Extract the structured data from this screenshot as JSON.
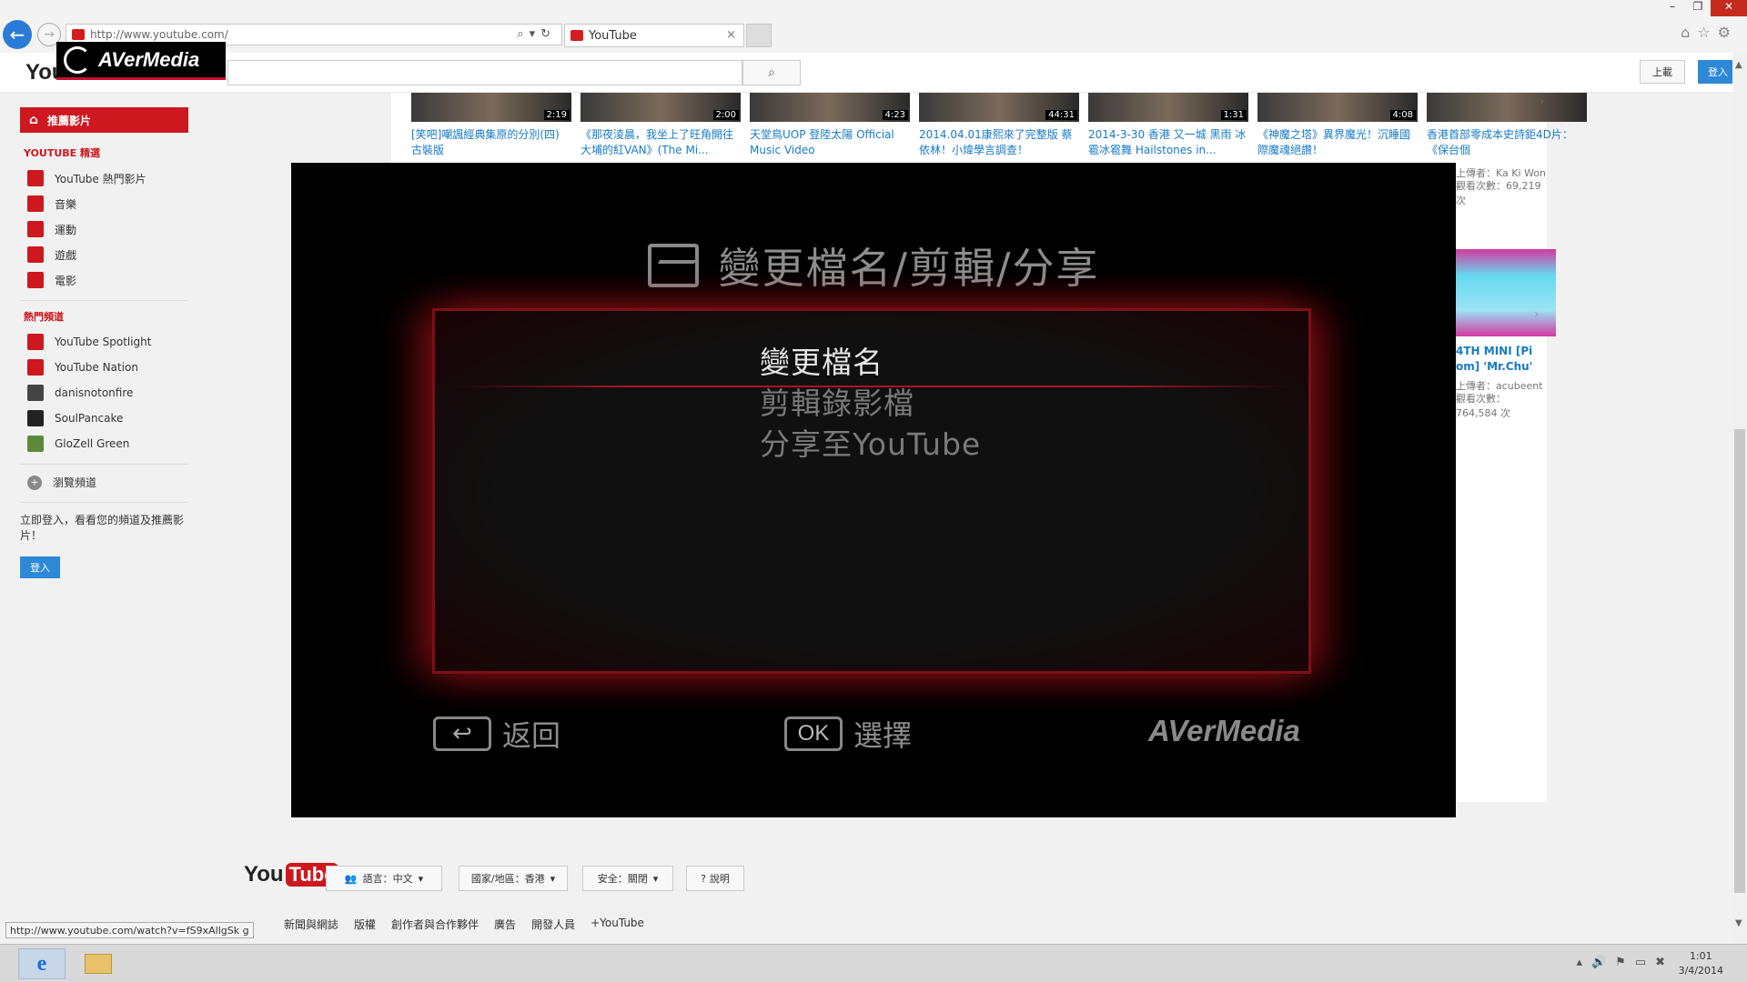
{
  "browser": {
    "url": "http://www.youtube.com/",
    "tab_title": "YouTube",
    "tab_close": "×",
    "window_controls": {
      "minimize": "–",
      "maximize": "❐",
      "close": "✕"
    }
  },
  "header": {
    "logo_partial": "You",
    "watermark": "AVerMedia",
    "upload": "上載",
    "signin": "登入"
  },
  "sidebar": {
    "home": "推薦影片",
    "section_best": "YOUTUBE 精選",
    "best_items": [
      {
        "label": "YouTube 熱門影片",
        "icon": "play-icon",
        "color": "#cc181e"
      },
      {
        "label": "音樂",
        "icon": "headphones-icon",
        "color": "#cc181e"
      },
      {
        "label": "運動",
        "icon": "trophy-icon",
        "color": "#cc181e"
      },
      {
        "label": "遊戲",
        "icon": "gamepad-icon",
        "color": "#cc181e"
      },
      {
        "label": "電影",
        "icon": "film-icon",
        "color": "#cc181e"
      }
    ],
    "section_channels": "熱門頻道",
    "channel_items": [
      {
        "label": "YouTube Spotlight",
        "icon": "spotlight-icon",
        "color": "#cc181e"
      },
      {
        "label": "YouTube Nation",
        "icon": "nation-icon",
        "color": "#cc181e"
      },
      {
        "label": "danisnotonfire",
        "icon": "avatar-icon",
        "color": "#444444"
      },
      {
        "label": "SoulPancake",
        "icon": "avatar-icon",
        "color": "#222222"
      },
      {
        "label": "GloZell Green",
        "icon": "avatar-icon",
        "color": "#5c8a3a"
      }
    ],
    "browse_channels": "瀏覽頻道",
    "prompt": "立即登入，看看您的頻道及推薦影片！",
    "signin": "登入"
  },
  "videos": [
    {
      "title": "[笑吧]嘲諷經典集原的分別(四) 古裝版",
      "duration": "2:19"
    },
    {
      "title": "《那夜淩晨，我坐上了旺角開往大埔的紅VAN》(The Mi...",
      "duration": "2:00"
    },
    {
      "title": "天堂鳥UOP 登陸太陽 Official Music Video",
      "duration": "4:23"
    },
    {
      "title": "2014.04.01康熙來了完整版 蔡依林！小煒學言調查！",
      "duration": "44:31"
    },
    {
      "title": "2014-3-30 香港 又一城 黑雨 冰雹冰雹舞 Hailstones in...",
      "duration": "1:31"
    },
    {
      "title": "《神魔之塔》異界魔光！沉睡國際魔魂絕讚！",
      "duration": "4:08"
    },
    {
      "title": "香港首部零成本史詩鉅4D片：《保台個",
      "duration": ""
    }
  ],
  "right_rail": {
    "meta1a": "上傳者：Ka Ki Won",
    "meta1b": "觀看次數：69,219 次",
    "title2": "4TH MINI [Pi om] 'Mr.Chu'",
    "meta2a": "上傳者：acubeent",
    "meta2b": "觀看次數：764,584 次"
  },
  "overlay": {
    "title": "變更檔名/剪輯/分享",
    "menu": [
      "變更檔名",
      "剪輯錄影檔",
      "分享至YouTube"
    ],
    "back_label": "返回",
    "ok_icon": "OK",
    "ok_label": "選擇",
    "brand": "AVerMedia"
  },
  "footer": {
    "logo_you": "You",
    "logo_tube": "Tube",
    "language": "語言：中文",
    "country": "國家/地區：香港",
    "safety": "安全：關閉",
    "help": "說明",
    "links": [
      "新聞與網誌",
      "版權",
      "創作者與合作夥伴",
      "廣告",
      "開發人員",
      "+YouTube"
    ]
  },
  "status_url": "http://www.youtube.com/watch?v=fS9xAllgSk g",
  "taskbar": {
    "time": "1:01",
    "date": "3/4/2014",
    "ie_glyph": "e"
  }
}
